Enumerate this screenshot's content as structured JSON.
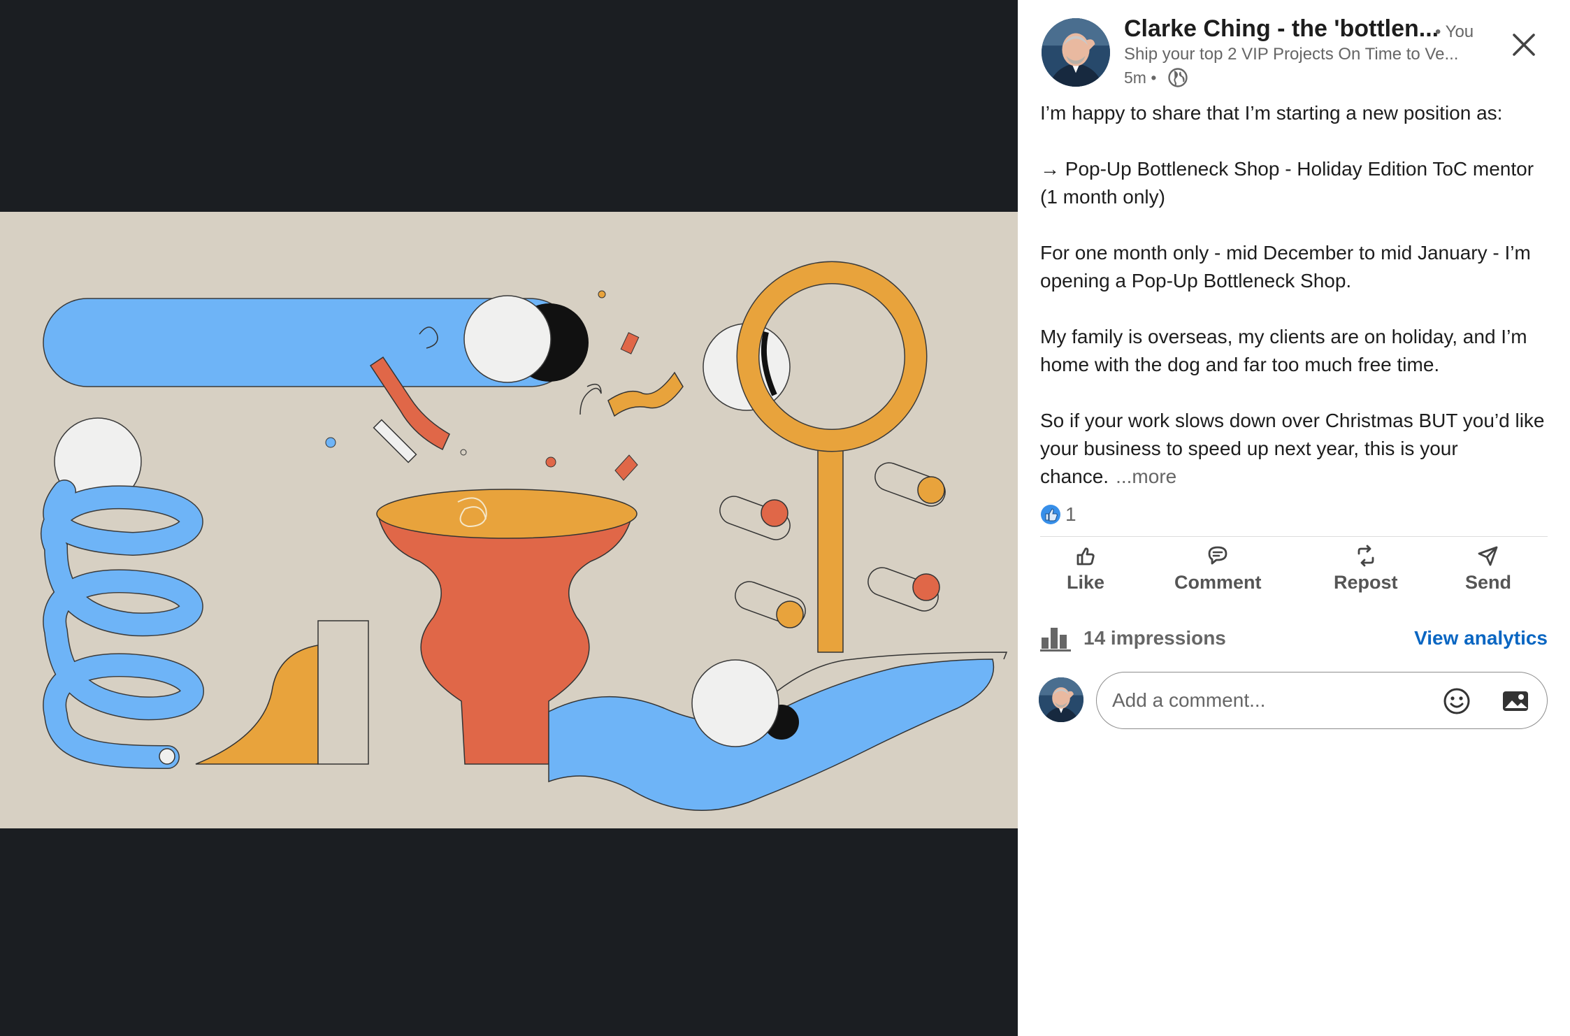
{
  "author": {
    "name": "Clarke Ching - the 'bottlen...",
    "connection": "• You",
    "headline": "Ship your top 2 VIP Projects On Time to Ve...",
    "time": "5m •"
  },
  "post": {
    "paragraphs": [
      "I’m happy to share that I’m starting a new position as:",
      "→ Pop-Up Bottleneck Shop - Holiday Edition ToC mentor (1 month only)",
      "For one month only - mid December to mid January - I’m opening a Pop-Up Bottleneck Shop.",
      "My family is overseas, my clients are on holiday, and I’m home with the dog and far too much free time.",
      "So if your work slows down over Christmas BUT you’d like your business to speed up next year, this is your chance."
    ],
    "more_label": "...more"
  },
  "reactions": {
    "count": "1"
  },
  "actions": {
    "like": "Like",
    "comment": "Comment",
    "repost": "Repost",
    "send": "Send"
  },
  "analytics": {
    "impressions": "14 impressions",
    "view_label": "View analytics"
  },
  "comment": {
    "placeholder": "Add a comment..."
  },
  "colors": {
    "media_background": "#1b1e22",
    "illustration_background": "#d7d0c3",
    "accent_blue": "#6eb4f7",
    "accent_orange": "#e8a33c",
    "accent_red": "#e06748",
    "link_blue": "#0a66c2"
  }
}
